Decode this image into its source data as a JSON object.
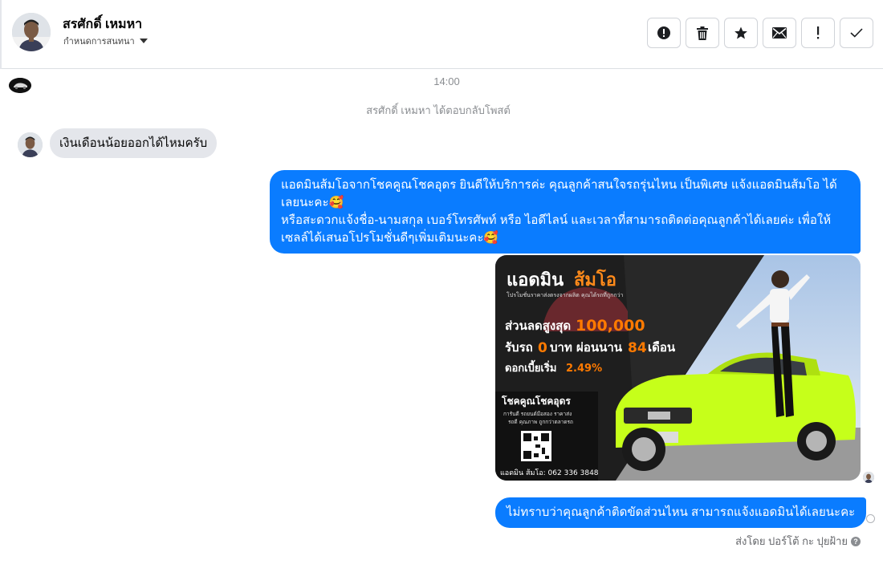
{
  "header": {
    "contact_name": "สรศักดิ์ เหมหา",
    "contact_sub": "กำหนดการสนทนา",
    "actions": [
      {
        "icon": "alert-circle-icon"
      },
      {
        "icon": "trash-icon"
      },
      {
        "icon": "star-icon"
      },
      {
        "icon": "envelope-icon"
      },
      {
        "icon": "exclamation-icon"
      },
      {
        "icon": "check-icon"
      }
    ]
  },
  "chat": {
    "timestamp": "14:00",
    "system_note": "สรศักดิ์ เหมหา ได้ตอบกลับโพสต์",
    "incoming_message": "เงินเดือนน้อยออกได้ไหมครับ",
    "outgoing_long": {
      "line1": "แอดมินส้มโอจากโชคคูณโชคอุดร ยินดีให้บริการค่ะ   คุณลูกค้าสนใจรถรุ่นไหน เป็นพิเศษ แจ้งแอดมินส้มโอ ได้",
      "line2": "เลยนะคะ🥰",
      "line3": "หรือสะดวกแจ้งชื่อ-นามสกุล เบอร์โทรศัพท์ หรือ ไอดีไลน์ และเวลาที่สามารถติดต่อคุณลูกค้าได้เลยค่ะ เพื่อให้",
      "line4": "เซลล์ได้เสนอโปรโมชั่นดีๆเพิ่มเติมนะคะ🥰"
    },
    "promo_image": {
      "headline_a": "แอดมิน",
      "headline_b": "ส้มโอ",
      "tagline": "โปรโมชั่นราคาส่งตรงจากผลิต คุณได้รถที่ถูกกว่า",
      "discount_label": "ส่วนลดสูงสุด",
      "discount_value": "100,000",
      "offer_line_a": "รับรถ",
      "offer_zero": "0",
      "offer_line_b": "บาท ผ่อนนาน",
      "offer_months": "84",
      "offer_line_c": "เดือน",
      "interest_label": "ดอกเบี้ยเริ่ม",
      "interest_value": "2.49%",
      "dealer_name": "โชคคูณโชคอุดร",
      "dealer_line1": "การันตี รถยนต์มือสอง ราคาส่ง",
      "dealer_line2": "รถดี คุณภาพ ถูกกว่าตลาดรถ",
      "contact": "แอดมิน ส้มโอ: 062 336 3848",
      "colors": {
        "accent_orange": "#ff7a00",
        "car_green": "#c6ff1a",
        "panel_dark": "#1a1a1a"
      }
    },
    "outgoing_short": "ไม่ทราบว่าคุณลูกค้าติดขัดส่วนไหน สามารถแจ้งแอดมินได้เลยนะคะ",
    "sent_by": "ส่งโดย ปอร์โต้ กะ ปุยฝ้าย",
    "help_glyph": "?"
  },
  "colors": {
    "bubble_out": "#0a7cff",
    "bubble_in": "#e4e6eb",
    "muted_text": "#8a8d91"
  }
}
